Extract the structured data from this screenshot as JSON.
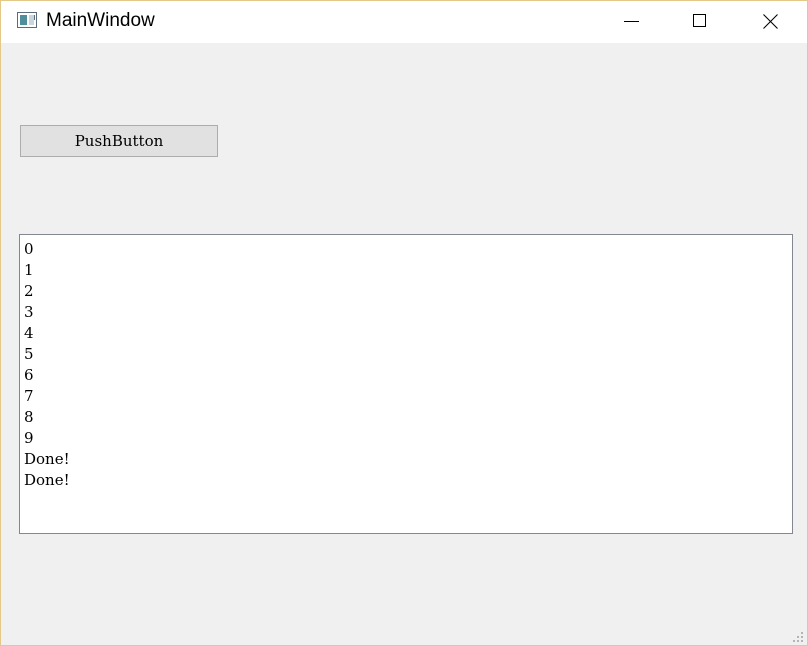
{
  "window": {
    "title": "MainWindow",
    "icons": {
      "app": "app-window-icon",
      "minimize": "minimize-icon",
      "maximize": "maximize-icon",
      "close": "close-icon",
      "grip": "resize-grip-icon"
    }
  },
  "main": {
    "push_button_label": "PushButton",
    "output_lines": [
      "0",
      "1",
      "2",
      "3",
      "4",
      "5",
      "6",
      "7",
      "8",
      "9",
      "Done!",
      "Done!"
    ]
  },
  "colors": {
    "background": "#f0f0f0",
    "titlebar": "#ffffff",
    "window_border": "#e3c88a",
    "button_face": "#e1e1e1",
    "button_border": "#adadad",
    "textbox_border": "#828790"
  }
}
